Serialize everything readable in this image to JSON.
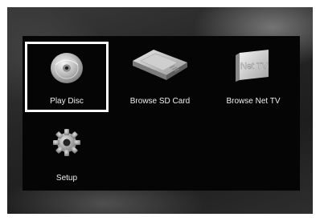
{
  "menu": {
    "items": [
      {
        "label": "Play Disc",
        "icon": "disc-icon",
        "selected": true
      },
      {
        "label": "Browse SD Card",
        "icon": "sd-card-icon",
        "selected": false
      },
      {
        "label": "Browse Net TV",
        "icon": "net-tv-icon",
        "selected": false
      },
      {
        "label": "Setup",
        "icon": "gear-icon",
        "selected": false
      }
    ],
    "net_tv_icon_text": "Net TV"
  },
  "colors": {
    "panel": "#050505",
    "text": "#f0f0f0",
    "selection_border": "#ffffff"
  }
}
